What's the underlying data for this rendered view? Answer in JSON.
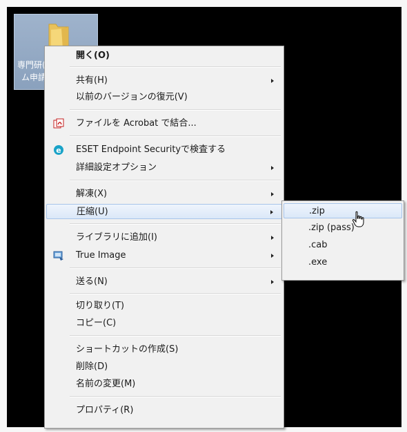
{
  "desktop_icon": {
    "label_line1": "専門研(",
    "label_line2": "ム申請"
  },
  "context_menu": {
    "items": [
      {
        "label": "開く(O)",
        "bold": true
      },
      {
        "label": "共有(H)"
      },
      {
        "label": "以前のバージョンの復元(V)"
      },
      {
        "label": "ファイルを Acrobat で結合..."
      },
      {
        "label": "ESET Endpoint Securityで検査する"
      },
      {
        "label": "詳細設定オプション"
      },
      {
        "label": "解凍(X)"
      },
      {
        "label": "圧縮(U)"
      },
      {
        "label": "ライブラリに追加(I)"
      },
      {
        "label": "True Image"
      },
      {
        "label": "送る(N)"
      },
      {
        "label": "切り取り(T)"
      },
      {
        "label": "コピー(C)"
      },
      {
        "label": "ショートカットの作成(S)"
      },
      {
        "label": "削除(D)"
      },
      {
        "label": "名前の変更(M)"
      },
      {
        "label": "プロパティ(R)"
      }
    ]
  },
  "compress_submenu": {
    "items": [
      {
        "label": ".zip"
      },
      {
        "label": ".zip (pass)"
      },
      {
        "label": ".cab"
      },
      {
        "label": ".exe"
      }
    ]
  },
  "colors": {
    "highlight_border": "#a7c4ea",
    "eset_blue": "#1aa3c8",
    "acrobat_red": "#c41e1e"
  }
}
